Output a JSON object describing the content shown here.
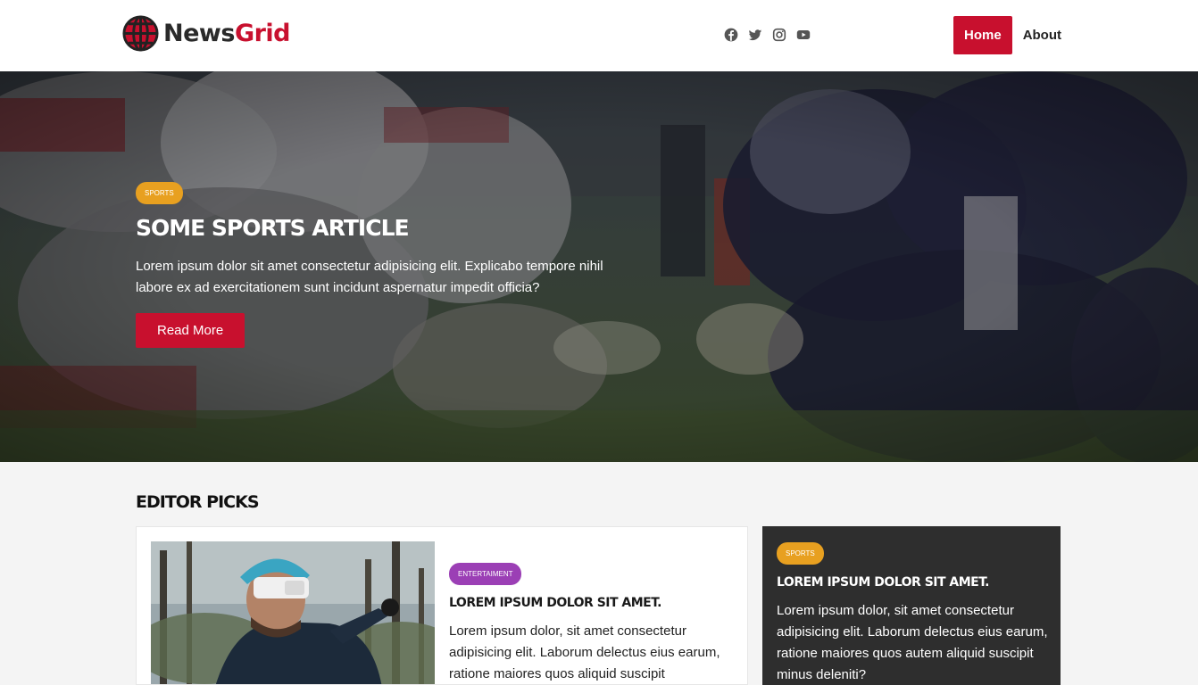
{
  "brand": {
    "name_part1": "News",
    "name_part2": "Grid",
    "accent": "#c8102e"
  },
  "social": [
    {
      "icon": "facebook-icon"
    },
    {
      "icon": "twitter-icon"
    },
    {
      "icon": "instagram-icon"
    },
    {
      "icon": "youtube-icon"
    }
  ],
  "nav": {
    "home": "Home",
    "about": "About"
  },
  "hero": {
    "category": "SPORTS",
    "title": "Some Sports Article",
    "text": "Lorem ipsum dolor sit amet consectetur adipisicing elit. Explicabo tempore nihil labore ex ad exercitationem sunt incidunt aspernatur impedit officia?",
    "button": "Read More"
  },
  "editor_picks": {
    "title": "Editor Picks",
    "cards": [
      {
        "category": "ENTERTAIMENT",
        "title": "Lorem ipsum dolor sit amet.",
        "text": "Lorem ipsum dolor, sit amet consectetur adipisicing elit. Laborum delectus eius earum, ratione maiores quos aliquid suscipit"
      },
      {
        "category": "SPORTS",
        "title": "Lorem ipsum dolor sit amet.",
        "text": "Lorem ipsum dolor, sit amet consectetur adipisicing elit. Laborum delectus eius earum, ratione maiores quos autem aliquid suscipit minus deleniti?"
      }
    ]
  },
  "colors": {
    "sports_badge": "#e8a020",
    "entertainment_badge": "#9b3fb5",
    "dark_card": "#2e2e2e"
  }
}
